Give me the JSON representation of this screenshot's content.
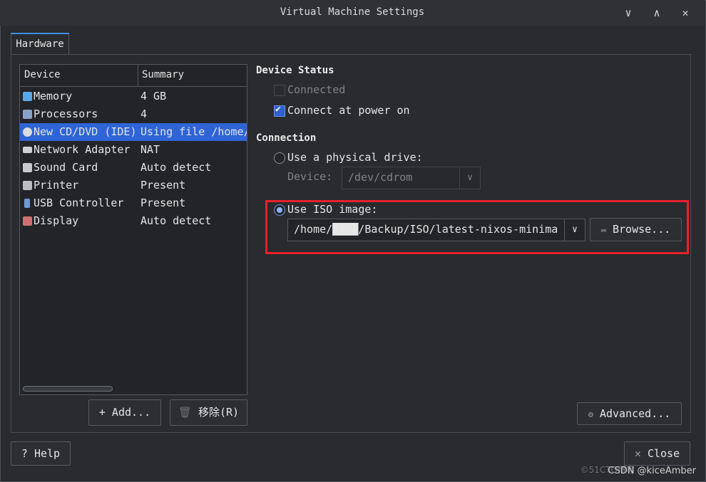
{
  "window": {
    "title": "Virtual Machine Settings"
  },
  "tabs": [
    {
      "label": "Hardware"
    }
  ],
  "device_list": {
    "headers": {
      "device": "Device",
      "summary": "Summary"
    },
    "rows": [
      {
        "name": "Memory",
        "summary": "4 GB",
        "icon": "memory-icon",
        "color": "#58a8e8"
      },
      {
        "name": "Processors",
        "summary": "4",
        "icon": "processor-icon",
        "color": "#8aa2c8"
      },
      {
        "name": "New CD/DVD (IDE)",
        "summary": "Using file /home/",
        "icon": "cd-icon",
        "color": "#dcdcdc"
      },
      {
        "name": "Network Adapter",
        "summary": "NAT",
        "icon": "network-icon",
        "color": "#d0d0d0"
      },
      {
        "name": "Sound Card",
        "summary": "Auto detect",
        "icon": "sound-icon",
        "color": "#c8c8c8"
      },
      {
        "name": "Printer",
        "summary": "Present",
        "icon": "printer-icon",
        "color": "#bcbcbc"
      },
      {
        "name": "USB Controller",
        "summary": "Present",
        "icon": "usb-icon",
        "color": "#6f9ad6"
      },
      {
        "name": "Display",
        "summary": "Auto detect",
        "icon": "display-icon",
        "color": "#d07070"
      }
    ],
    "selected_index": 2
  },
  "buttons": {
    "add": "+ Add...",
    "remove": "移除(R)",
    "advanced": "Advanced...",
    "help": "? Help",
    "close": "Close",
    "browse": "Browse..."
  },
  "device_status": {
    "heading": "Device Status",
    "connected": {
      "label": "Connected",
      "checked": false,
      "disabled": true
    },
    "connect_at_power_on": {
      "label": "Connect at power on",
      "checked": true
    }
  },
  "connection": {
    "heading": "Connection",
    "physical_drive": {
      "label": "Use a physical drive:",
      "selected": false
    },
    "device_label": "Device:",
    "device_value": "/dev/cdrom",
    "iso": {
      "label": "Use ISO image:",
      "selected": true,
      "path": "/home/████/Backup/ISO/latest-nixos-minima"
    }
  },
  "watermark": "CSDN @kiceAmber",
  "watermark_faint": "©51CTO博客"
}
